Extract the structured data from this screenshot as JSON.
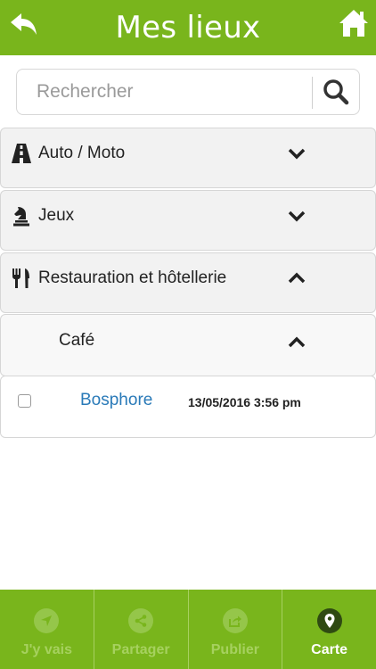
{
  "header": {
    "title": "Mes lieux"
  },
  "search": {
    "placeholder": "Rechercher",
    "value": ""
  },
  "categories": [
    {
      "label": "Auto / Moto",
      "icon": "road-icon",
      "expanded": false
    },
    {
      "label": "Jeux",
      "icon": "chess-knight-icon",
      "expanded": false
    },
    {
      "label": "Restauration et hôtellerie",
      "icon": "fork-knife-icon",
      "expanded": true
    }
  ],
  "subcategory": {
    "label": "Café",
    "expanded": true
  },
  "places": [
    {
      "name": "Bosphore",
      "date": "13/05/2016 3:56 pm",
      "checked": false
    }
  ],
  "bottom_tabs": [
    {
      "label": "J'y vais",
      "icon": "navigation-arrow-icon",
      "active": false
    },
    {
      "label": "Partager",
      "icon": "share-icon",
      "active": false
    },
    {
      "label": "Publier",
      "icon": "publish-icon",
      "active": false
    },
    {
      "label": "Carte",
      "icon": "map-marker-icon",
      "active": true
    }
  ],
  "colors": {
    "brand_green": "#79b51c",
    "link_blue": "#2a7ab8"
  }
}
